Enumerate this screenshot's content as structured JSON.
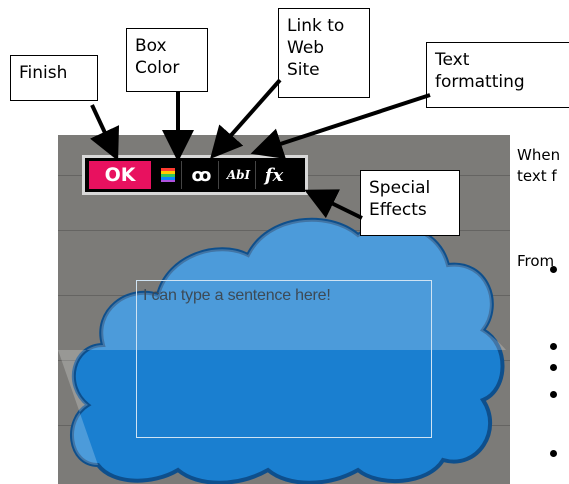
{
  "callouts": {
    "finish": "Finish",
    "box_color": "Box\nColor",
    "link": "Link to\nWeb\nSite",
    "text_formatting": "Text\nformatting",
    "special_effects": "Special\nEffects"
  },
  "toolbar": {
    "ok_label": "OK",
    "link_label": "ꝏ",
    "format_label": "AbI",
    "fx_label": "fx"
  },
  "editor": {
    "text": "I can type a sentence here!"
  },
  "side": {
    "line1": "When",
    "line2": "text f",
    "line3": "From"
  },
  "colors": {
    "ok_button": "#e8115f",
    "cloud": "#1a7fd0",
    "background": "#7c7b78"
  }
}
